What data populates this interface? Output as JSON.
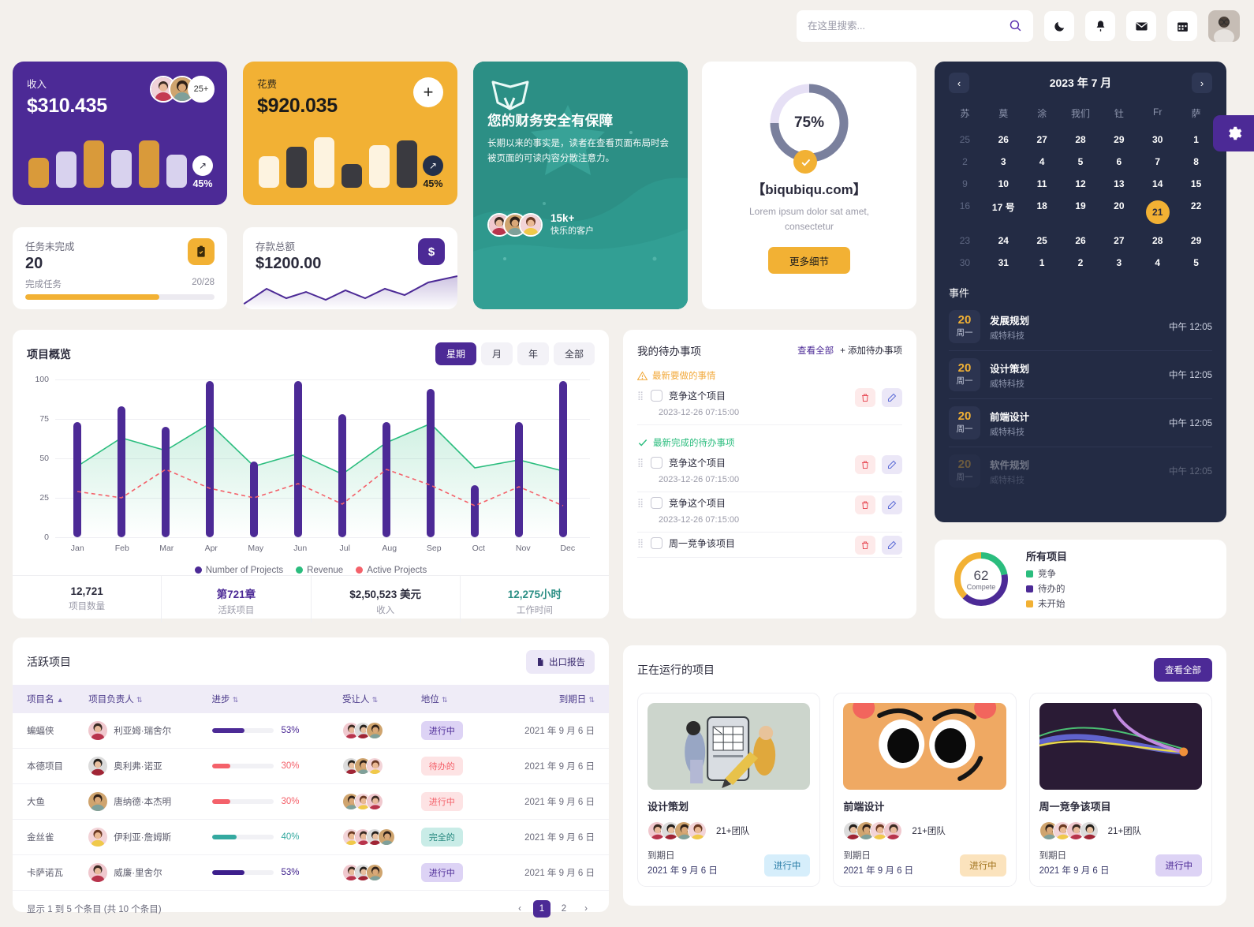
{
  "header": {
    "search_placeholder": "在这里搜索...",
    "search_value": "",
    "icons": [
      "moon-icon",
      "bell-icon",
      "mail-icon",
      "calendar-icon",
      "avatar"
    ]
  },
  "income_card": {
    "label": "收入",
    "amount": "$310.435",
    "more_avatars": "25+",
    "pct": "45%",
    "arrow": "↗"
  },
  "expense_card": {
    "label": "花费",
    "amount": "$920.035",
    "plus": "+",
    "pct": "45%",
    "arrow": "↗"
  },
  "tasks_card": {
    "label": "任务未完成",
    "value": "20",
    "sub": "完成任务",
    "ratio": "20/28",
    "progress": 71
  },
  "deposit_card": {
    "label": "存款总额",
    "value": "$1200.00"
  },
  "promo": {
    "title": "您的财务安全有保障",
    "body": "长期以来的事实是，读者在查看页面布局时会被页面的可读内容分散注意力。",
    "count": "15k+",
    "count_sub": "快乐的客户"
  },
  "gauge": {
    "percent": "75%",
    "value": 75,
    "domain": "【biqubiqu.com】",
    "sub": "Lorem ipsum dolor sat amet, consectetur",
    "button": "更多细节"
  },
  "calendar": {
    "title": "2023 年 7 月",
    "prev": "‹",
    "next": "›",
    "dow": [
      "苏",
      "莫",
      "涂",
      "我们",
      "钍",
      "Fr",
      "萨"
    ],
    "weeks": [
      [
        {
          "d": "25",
          "s": "off"
        },
        {
          "d": "26",
          "s": "on"
        },
        {
          "d": "27",
          "s": "on"
        },
        {
          "d": "28",
          "s": "on"
        },
        {
          "d": "29",
          "s": "on"
        },
        {
          "d": "30",
          "s": "on"
        },
        {
          "d": "1",
          "s": "on"
        }
      ],
      [
        {
          "d": "2",
          "s": "off"
        },
        {
          "d": "3",
          "s": "on"
        },
        {
          "d": "4",
          "s": "on"
        },
        {
          "d": "5",
          "s": "on"
        },
        {
          "d": "6",
          "s": "on"
        },
        {
          "d": "7",
          "s": "on"
        },
        {
          "d": "8",
          "s": "on"
        }
      ],
      [
        {
          "d": "9",
          "s": "off"
        },
        {
          "d": "10",
          "s": "on"
        },
        {
          "d": "11",
          "s": "on"
        },
        {
          "d": "12",
          "s": "on"
        },
        {
          "d": "13",
          "s": "on"
        },
        {
          "d": "14",
          "s": "on"
        },
        {
          "d": "15",
          "s": "on"
        }
      ],
      [
        {
          "d": "16",
          "s": "off"
        },
        {
          "d": "17 号",
          "s": "on"
        },
        {
          "d": "18",
          "s": "on"
        },
        {
          "d": "19",
          "s": "on"
        },
        {
          "d": "20",
          "s": "on"
        },
        {
          "d": "21",
          "s": "sel"
        },
        {
          "d": "22",
          "s": "on"
        }
      ],
      [
        {
          "d": "23",
          "s": "off"
        },
        {
          "d": "24",
          "s": "on"
        },
        {
          "d": "25",
          "s": "on"
        },
        {
          "d": "26",
          "s": "on"
        },
        {
          "d": "27",
          "s": "on"
        },
        {
          "d": "28",
          "s": "on"
        },
        {
          "d": "29",
          "s": "on"
        }
      ],
      [
        {
          "d": "30",
          "s": "off"
        },
        {
          "d": "31",
          "s": "on"
        },
        {
          "d": "1",
          "s": "on"
        },
        {
          "d": "2",
          "s": "on"
        },
        {
          "d": "3",
          "s": "on"
        },
        {
          "d": "4",
          "s": "on"
        },
        {
          "d": "5",
          "s": "on"
        }
      ]
    ],
    "events_title": "事件",
    "events": [
      {
        "day": "20",
        "dow": "周一",
        "name": "发展规划",
        "company": "威特科技",
        "time": "中午 12:05"
      },
      {
        "day": "20",
        "dow": "周一",
        "name": "设计策划",
        "company": "威特科技",
        "time": "中午 12:05"
      },
      {
        "day": "20",
        "dow": "周一",
        "name": "前端设计",
        "company": "威特科技",
        "time": "中午 12:05"
      },
      {
        "day": "20",
        "dow": "周一",
        "name": "软件规划",
        "company": "威特科技",
        "time": "中午 12:05"
      }
    ]
  },
  "chart_card": {
    "title": "项目概览",
    "tabs": [
      {
        "label": "星期",
        "active": true
      },
      {
        "label": "月",
        "active": false
      },
      {
        "label": "年",
        "active": false
      },
      {
        "label": "全部",
        "active": false
      }
    ],
    "stats": [
      {
        "value": "12,721",
        "label": "项目数量",
        "color": "#2b2b3c"
      },
      {
        "value": "第721章",
        "label": "活跃项目",
        "color": "#4c2a96"
      },
      {
        "value": "$2,50,523 美元",
        "label": "收入",
        "color": "#2b2b3c"
      },
      {
        "value": "12,275小时",
        "label": "工作时间",
        "color": "#2c8f85"
      }
    ]
  },
  "chart_data": {
    "type": "bar",
    "title": "项目概览",
    "xlabel": "",
    "ylabel": "",
    "ylim": [
      0,
      100
    ],
    "yticks": [
      0,
      25,
      50,
      75,
      100
    ],
    "grid": true,
    "legend_position": "bottom",
    "categories": [
      "Jan",
      "Feb",
      "Mar",
      "Apr",
      "May",
      "Jun",
      "Jul",
      "Aug",
      "Sep",
      "Oct",
      "Nov",
      "Dec"
    ],
    "series": [
      {
        "name": "Number of Projects",
        "type": "bar",
        "color": "#4c2a96",
        "values": [
          73,
          83,
          70,
          99,
          48,
          99,
          78,
          73,
          94,
          33,
          73,
          99
        ]
      },
      {
        "name": "Revenue",
        "type": "area",
        "color": "#2bbd7e",
        "values": [
          45,
          63,
          55,
          72,
          45,
          53,
          40,
          60,
          72,
          44,
          49,
          42
        ]
      },
      {
        "name": "Active Projects",
        "type": "line-dashed",
        "color": "#f4616a",
        "values": [
          29,
          25,
          43,
          31,
          25,
          34,
          21,
          43,
          33,
          20,
          32,
          20
        ]
      }
    ]
  },
  "todo": {
    "title": "我的待办事项",
    "view_all": "查看全部",
    "add": "+ 添加待办事项",
    "group_pending": "最新要做的事情",
    "group_done": "最新完成的待办事项",
    "items": [
      {
        "text": "竞争这个项目",
        "time": "2023-12-26 07:15:00",
        "group": "pending"
      },
      {
        "text": "竞争这个项目",
        "time": "2023-12-26 07:15:00",
        "group": "done"
      },
      {
        "text": "竞争这个项目",
        "time": "2023-12-26 07:15:00",
        "group": ""
      },
      {
        "text": "周一竞争该项目",
        "time": "",
        "group": ""
      }
    ]
  },
  "all_projects": {
    "center_value": "62",
    "center_label": "Compete",
    "title": "所有项目",
    "legend": [
      {
        "label": "竞争",
        "color": "#2bbd7e",
        "value": 22
      },
      {
        "label": "待办的",
        "color": "#4c2a96",
        "value": 40
      },
      {
        "label": "未开始",
        "color": "#f2b134",
        "value": 38
      }
    ]
  },
  "table": {
    "title": "活跃项目",
    "export": "出口报告",
    "columns": [
      "项目名",
      "项目负责人",
      "进步",
      "受让人",
      "地位",
      "到期日"
    ],
    "rows": [
      {
        "name": "蝙蝠侠",
        "owner": "利亚姆·瑞舍尔",
        "progress": 53,
        "pct": "53%",
        "pcolor": "#4c2a96",
        "assignees": 3,
        "status": "进行中",
        "sbg": "#ddd3f5",
        "sfg": "#4c2a96",
        "due": "2021 年 9 月 6 日"
      },
      {
        "name": "本德项目",
        "owner": "奥利弗·诺亚",
        "progress": 30,
        "pct": "30%",
        "pcolor": "#f4616a",
        "assignees": 3,
        "status": "待办的",
        "sbg": "#fde3e4",
        "sfg": "#f4616a",
        "due": "2021 年 9 月 6 日"
      },
      {
        "name": "大鱼",
        "owner": "唐纳德·本杰明",
        "progress": 30,
        "pct": "30%",
        "pcolor": "#f4616a",
        "assignees": 3,
        "status": "进行中",
        "sbg": "#fde3e4",
        "sfg": "#f4616a",
        "due": "2021 年 9 月 6 日"
      },
      {
        "name": "金丝雀",
        "owner": "伊利亚·詹姆斯",
        "progress": 40,
        "pct": "40%",
        "pcolor": "#34a9a0",
        "assignees": 4,
        "status": "完全的",
        "sbg": "#c9ece7",
        "sfg": "#23867d",
        "due": "2021 年 9 月 6 日"
      },
      {
        "name": "卡萨诺瓦",
        "owner": "威廉·里舍尔",
        "progress": 53,
        "pct": "53%",
        "pcolor": "#3d1f8c",
        "assignees": 3,
        "status": "进行中",
        "sbg": "#ddd3f5",
        "sfg": "#4c2a96",
        "due": "2021 年 9 月 6 日"
      }
    ],
    "footer": "显示 1 到 5 个条目 (共 10 个条目)",
    "pager": {
      "prev": "‹",
      "next": "›",
      "pages": [
        "1",
        "2"
      ],
      "current": "1"
    }
  },
  "running": {
    "title": "正在运行的项目",
    "view_all": "查看全部",
    "due_label": "到期日",
    "cards": [
      {
        "name": "设计策划",
        "team": "21+团队",
        "due": "2021 年 9 月 6 日",
        "status": "进行中",
        "sbg": "#d6eefb",
        "sfg": "#2c7fa8",
        "thumb": "wireframe"
      },
      {
        "name": "前端设计",
        "team": "21+团队",
        "due": "2021 年 9 月 6 日",
        "status": "进行中",
        "sbg": "#fbe3bd",
        "sfg": "#a2741f",
        "thumb": "mascot"
      },
      {
        "name": "周一竞争该项目",
        "team": "21+团队",
        "due": "2021 年 9 月 6 日",
        "status": "进行中",
        "sbg": "#ddd3f5",
        "sfg": "#4c2a96",
        "thumb": "lines"
      }
    ]
  }
}
